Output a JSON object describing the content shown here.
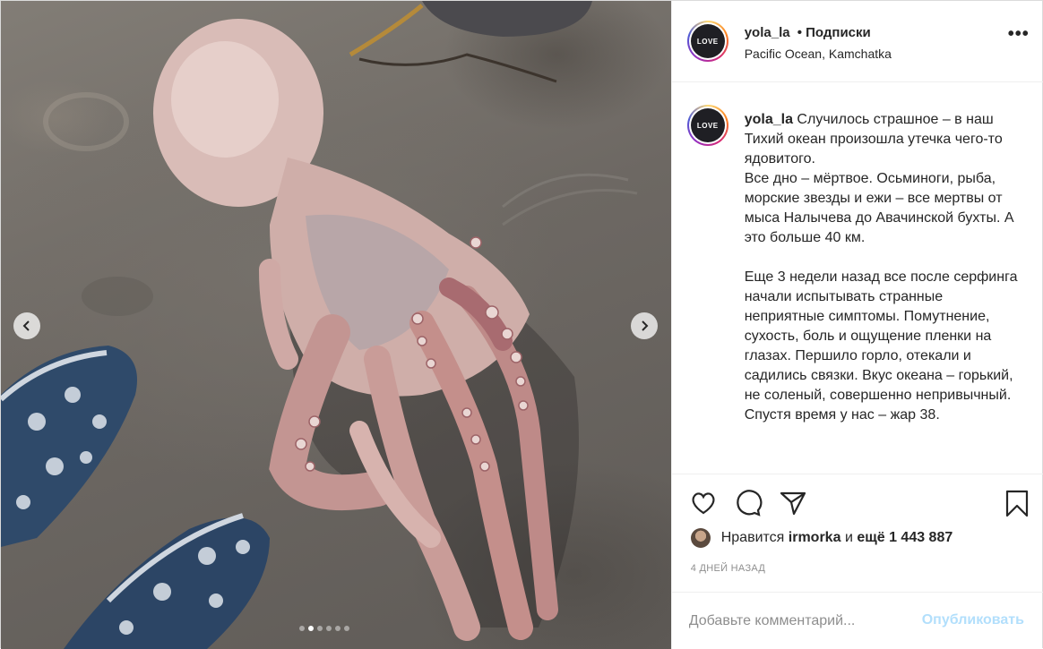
{
  "header": {
    "username": "yola_la",
    "follow_label": "• Подписки",
    "location": "Pacific Ocean, Kamchatka",
    "more_label": "•••",
    "avatar_text": "LOVE"
  },
  "caption": {
    "username": "yola_la",
    "text": " Случилось страшное – в наш Тихий океан произошла утечка чего-то ядовитого.\nВсе дно – мёртвое. Осьминоги, рыба, морские звезды и ежи – все мертвы от мыса Налычева до Авачинской бухты. А это больше 40 км.\n\nЕще 3 недели назад все после серфинга начали испытывать странные неприятные симптомы. Помутнение, сухость, боль и ощущение пленки на глазах. Першило горло, отекали и садились связки. Вкус океана – горький, не соленый, совершенно непривычный. Спустя время у нас – жар 38."
  },
  "actions": {
    "icons": [
      "heart-icon",
      "comment-icon",
      "share-icon",
      "bookmark-icon"
    ]
  },
  "likes": {
    "prefix": "Нравится",
    "user": "irmorka",
    "middle": "и",
    "count": "ещё 1 443 887"
  },
  "timestamp": "4 ДНЕЙ НАЗАД",
  "comment": {
    "placeholder": "Добавьте комментарий...",
    "publish_label": "Опубликовать"
  },
  "carousel": {
    "total_slides": 6,
    "active_index": 1
  },
  "colors": {
    "publish_disabled": "#b2dffc",
    "muted_text": "#8e8e8e",
    "border": "#efefef"
  }
}
